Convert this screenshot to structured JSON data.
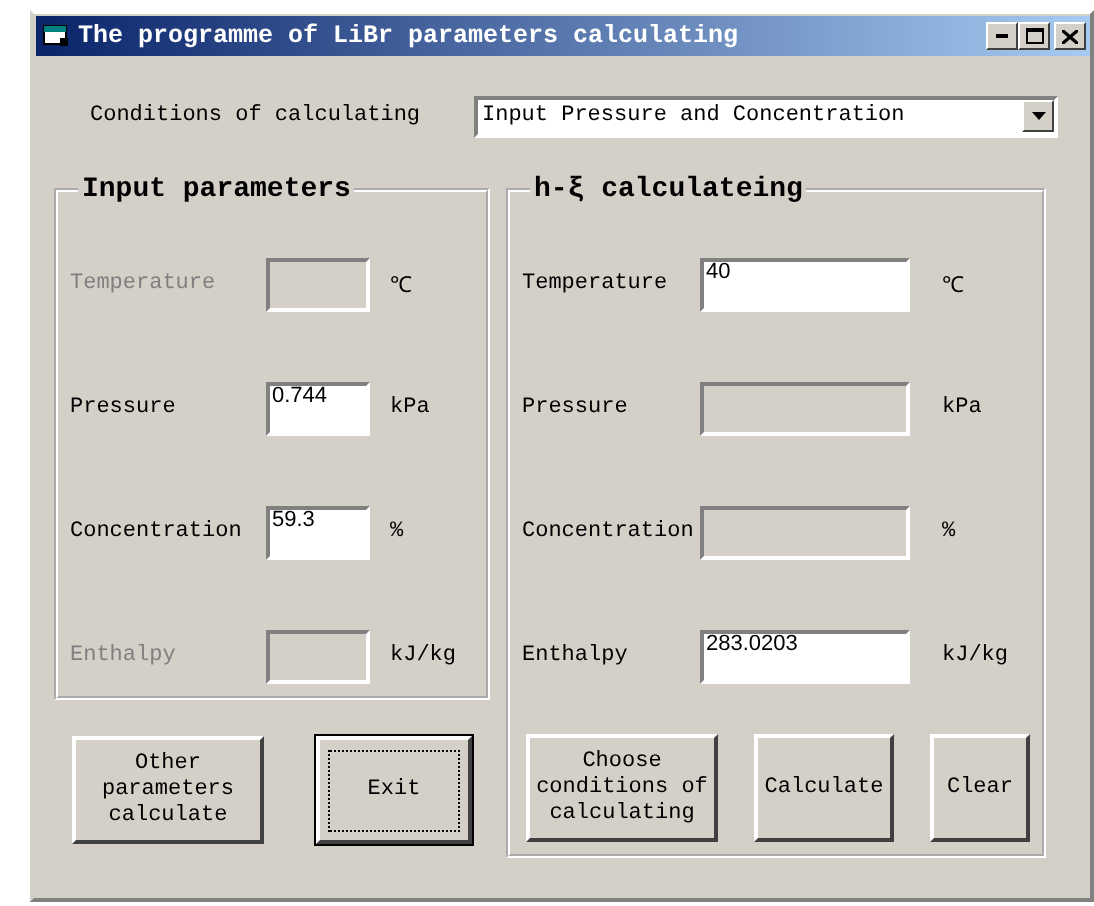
{
  "window": {
    "title": "The programme of LiBr parameters calculating"
  },
  "conditions": {
    "label": "Conditions of calculating",
    "value": "Input Pressure and Concentration"
  },
  "input_parameters": {
    "title": "Input parameters",
    "rows": [
      {
        "label": "Temperature",
        "unit": "℃",
        "disabled": true,
        "label_greyed": true
      },
      {
        "label": "Pressure",
        "value": "0.744",
        "unit": "kPa",
        "disabled": false,
        "label_greyed": false
      },
      {
        "label": "Concentration",
        "value": "59.3",
        "unit": "%",
        "disabled": false,
        "label_greyed": false
      },
      {
        "label": "Enthalpy",
        "unit": "kJ/kg",
        "disabled": true,
        "label_greyed": true
      }
    ],
    "buttons": [
      {
        "label": "Other parameters calculate",
        "default": false
      },
      {
        "label": "Exit",
        "default": true
      }
    ]
  },
  "h_xi_calculating": {
    "title": "h-ξ calculateing",
    "rows": [
      {
        "label": "Temperature",
        "value": "40",
        "unit": "℃",
        "disabled": false,
        "label_greyed": false
      },
      {
        "label": "Pressure",
        "unit": "kPa",
        "disabled": true,
        "label_greyed": false
      },
      {
        "label": "Concentration",
        "unit": "%",
        "disabled": true,
        "label_greyed": false
      },
      {
        "label": "Enthalpy",
        "value": "283.0203",
        "unit": "kJ/kg",
        "disabled": false,
        "label_greyed": false
      }
    ],
    "buttons": [
      {
        "label": "Choose conditions of calculating",
        "default": false
      },
      {
        "label": "Calculate",
        "default": false
      },
      {
        "label": "Clear",
        "default": false
      }
    ]
  }
}
